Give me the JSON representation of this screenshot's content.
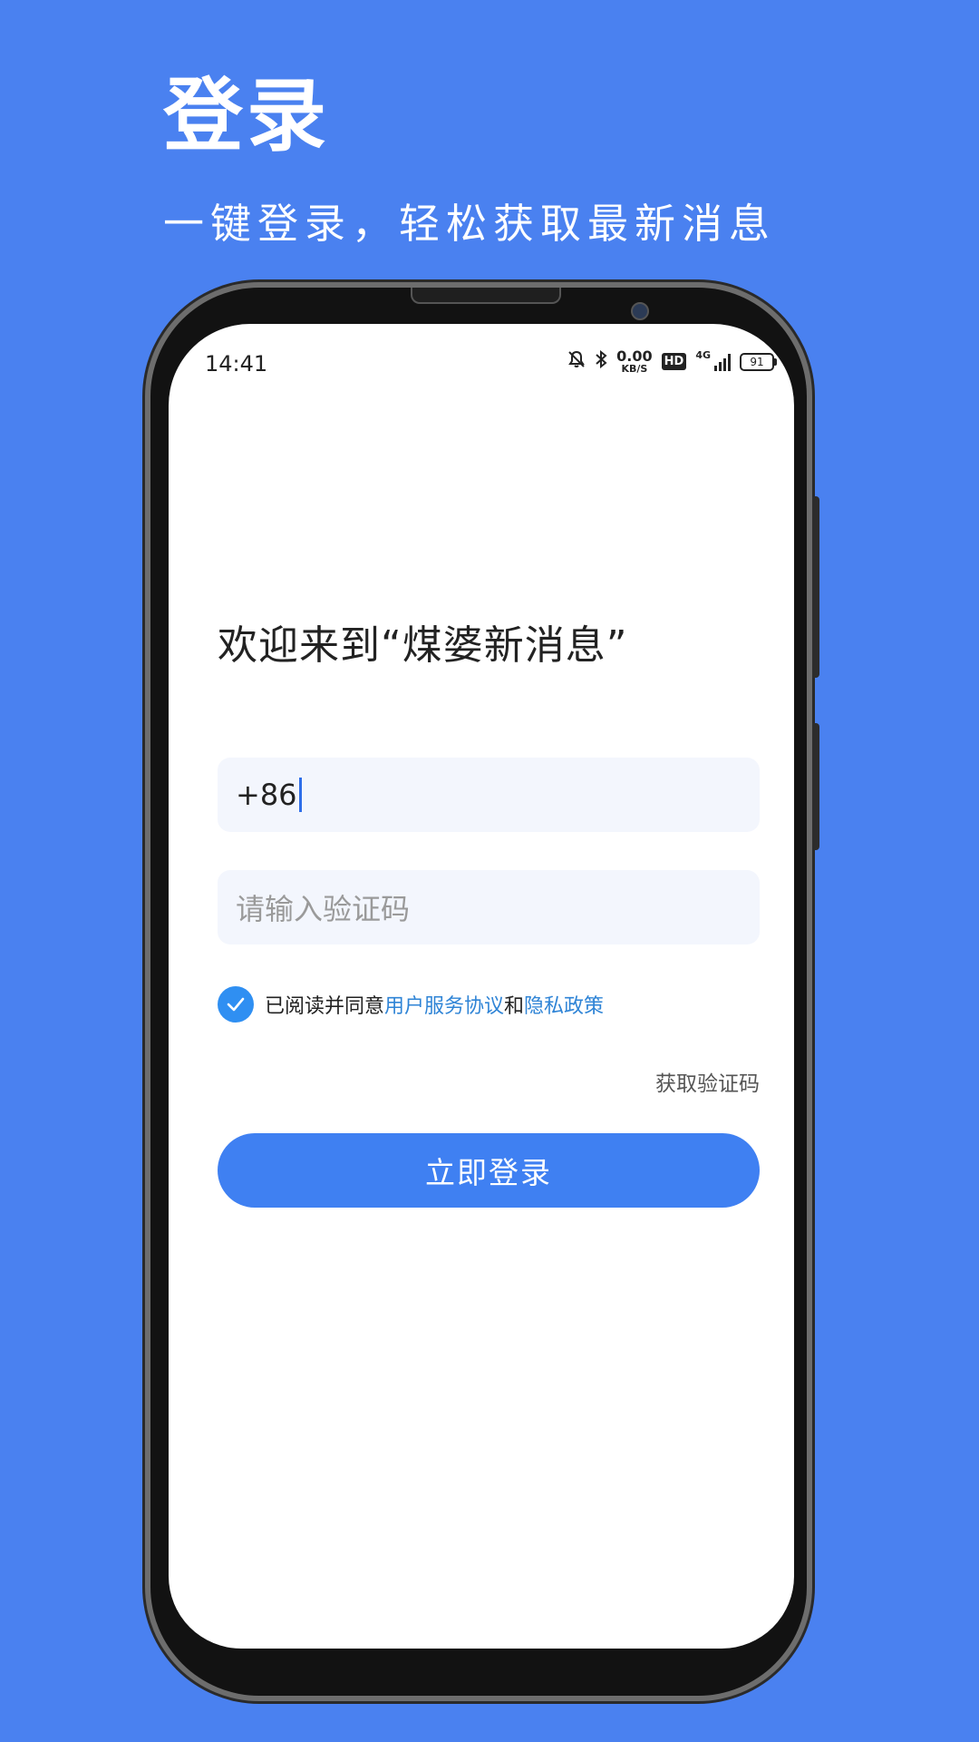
{
  "hero": {
    "title": "登录",
    "subtitle": "一键登录，轻松获取最新消息"
  },
  "status_bar": {
    "time": "14:41",
    "net_speed_value": "0.00",
    "net_speed_unit": "KB/S",
    "hd_label": "HD",
    "network_type": "4G",
    "battery": "91",
    "icons": [
      "bell-muted-icon",
      "bluetooth-icon",
      "hd-icon",
      "signal-icon",
      "battery-icon"
    ]
  },
  "login": {
    "welcome": "欢迎来到“煤婆新消息”",
    "phone_value": "+86",
    "code_placeholder": "请输入验证码",
    "agree_prefix": "已阅读并同意",
    "agree_link_terms": "用户服务协议",
    "agree_and": "和",
    "agree_link_privacy": "隐私政策",
    "agree_checked": true,
    "get_code_label": "获取验证码",
    "login_button": "立即登录"
  },
  "colors": {
    "background": "#4a81f0",
    "primary_button": "#3f80f2",
    "link": "#2f84d6",
    "checkbox": "#2f8ff2",
    "input_bg": "#f3f6fd"
  }
}
